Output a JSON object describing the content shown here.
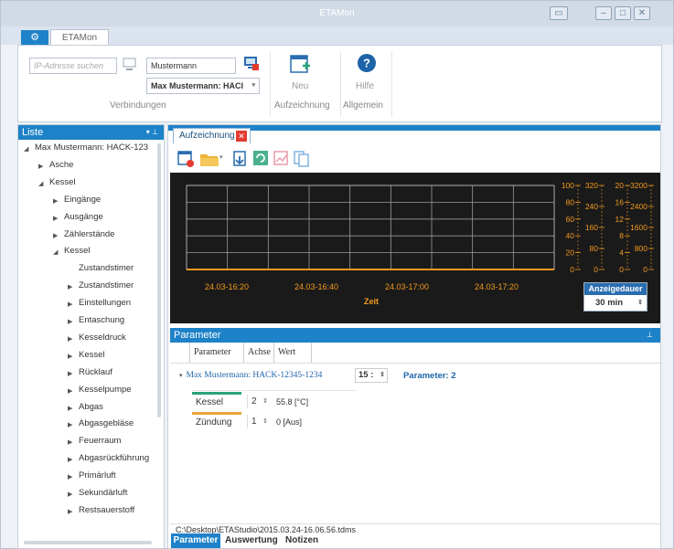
{
  "window": {
    "title": "ETAMon"
  },
  "ribbon_tab": {
    "label": "ETAMon"
  },
  "ribbon": {
    "ip_search_placeholder": "IP-Adresse suchen",
    "user_name": "Mustermann",
    "connection_select": "Max Mustermann: HACI",
    "new_label": "Neu",
    "help_label": "Hilfe",
    "group_connections": "Verbindungen",
    "group_recording": "Aufzeichnung",
    "group_general": "Allgemein"
  },
  "list": {
    "title": "Liste",
    "items": [
      {
        "label": "Max Mustermann: HACK-123",
        "level": 0,
        "arrow": "down"
      },
      {
        "label": "Asche",
        "level": 1,
        "arrow": "right"
      },
      {
        "label": "Kessel",
        "level": 1,
        "arrow": "down"
      },
      {
        "label": "Eingänge",
        "level": 2,
        "arrow": "right"
      },
      {
        "label": "Ausgänge",
        "level": 2,
        "arrow": "right"
      },
      {
        "label": "Zählerstände",
        "level": 2,
        "arrow": "right"
      },
      {
        "label": "Kessel",
        "level": 2,
        "arrow": "down"
      },
      {
        "label": "Zustandstimer",
        "level": 3,
        "arrow": ""
      },
      {
        "label": "Zustandstimer",
        "level": 3,
        "arrow": "right"
      },
      {
        "label": "Einstellungen",
        "level": 3,
        "arrow": "right"
      },
      {
        "label": "Entaschung",
        "level": 3,
        "arrow": "right"
      },
      {
        "label": "Kesseldruck",
        "level": 3,
        "arrow": "right"
      },
      {
        "label": "Kessel",
        "level": 3,
        "arrow": "right"
      },
      {
        "label": "Rücklauf",
        "level": 3,
        "arrow": "right"
      },
      {
        "label": "Kesselpumpe",
        "level": 3,
        "arrow": "right"
      },
      {
        "label": "Abgas",
        "level": 3,
        "arrow": "right"
      },
      {
        "label": "Abgasgebläse",
        "level": 3,
        "arrow": "right"
      },
      {
        "label": "Feuerraum",
        "level": 3,
        "arrow": "right"
      },
      {
        "label": "Abgasrückführung",
        "level": 3,
        "arrow": "right"
      },
      {
        "label": "Primärluft",
        "level": 3,
        "arrow": "right"
      },
      {
        "label": "Sekundärluft",
        "level": 3,
        "arrow": "right"
      },
      {
        "label": "Restsauerstoff",
        "level": 3,
        "arrow": "right"
      }
    ]
  },
  "recording": {
    "tab_label": "Aufzeichnung"
  },
  "chart_data": {
    "type": "line",
    "x": [
      "24.03-16:20",
      "24.03-16:40",
      "24.03-17:00",
      "24.03-17:20"
    ],
    "xlabel": "Zeit",
    "y_axes": [
      {
        "ticks": [
          0,
          20,
          40,
          60,
          80,
          100
        ],
        "color": "#f39a1e"
      },
      {
        "ticks": [
          0,
          80,
          160,
          240,
          320
        ],
        "color": "#f39a1e"
      },
      {
        "ticks": [
          0,
          4,
          8,
          12,
          16,
          20
        ],
        "color": "#f39a1e"
      },
      {
        "ticks": [
          0,
          800,
          1600,
          2400,
          3200
        ],
        "color": "#f39a1e"
      }
    ],
    "series": [
      {
        "values": [
          0,
          0,
          0,
          0,
          0
        ],
        "color": "#f39a1e"
      }
    ],
    "grid": true,
    "duration_label": "Anzeigedauer",
    "duration_value": "30 min"
  },
  "parameter": {
    "title": "Parameter",
    "columns": [
      "Parameter",
      "Achse",
      "Wert"
    ],
    "group_label": "Max Mustermann: HACK-12345-1234",
    "group_num": "15 :",
    "group_count": "Parameter: 2",
    "rows": [
      {
        "name": "Kessel",
        "axis": "2",
        "value": "55.8 [°C]",
        "color": "#2aa37a"
      },
      {
        "name": "Zündung",
        "axis": "1",
        "value": "0 [Aus]",
        "color": "#e8a33c"
      }
    ],
    "file_path": "C:\\Desktop\\ETAStudio\\2015.03.24-16.06.56.tdms"
  },
  "bottom_tabs": [
    "Parameter",
    "Auswertung",
    "Notizen"
  ],
  "colors": {
    "accent": "#1e82c8",
    "chart_bg": "#1a1a1a",
    "chart_axis": "#f39a1e",
    "close_red": "#e23b2e"
  }
}
